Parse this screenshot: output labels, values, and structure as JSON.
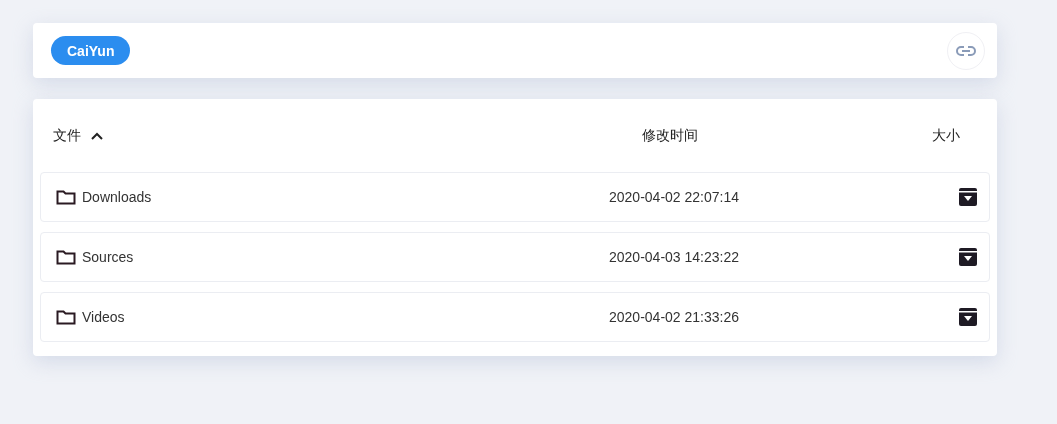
{
  "header": {
    "user_chip": "CaiYun"
  },
  "table": {
    "columns": [
      {
        "label": "文件",
        "sorted": true
      },
      {
        "label": "修改时间",
        "sorted": false
      },
      {
        "label": "大小",
        "sorted": false
      }
    ],
    "rows": [
      {
        "kind": "folder",
        "name": "Downloads",
        "modified": "2020-04-02 22:07:14"
      },
      {
        "kind": "folder",
        "name": "Sources",
        "modified": "2020-04-03 14:23:22"
      },
      {
        "kind": "folder",
        "name": "Videos",
        "modified": "2020-04-02 21:33:26"
      }
    ]
  }
}
